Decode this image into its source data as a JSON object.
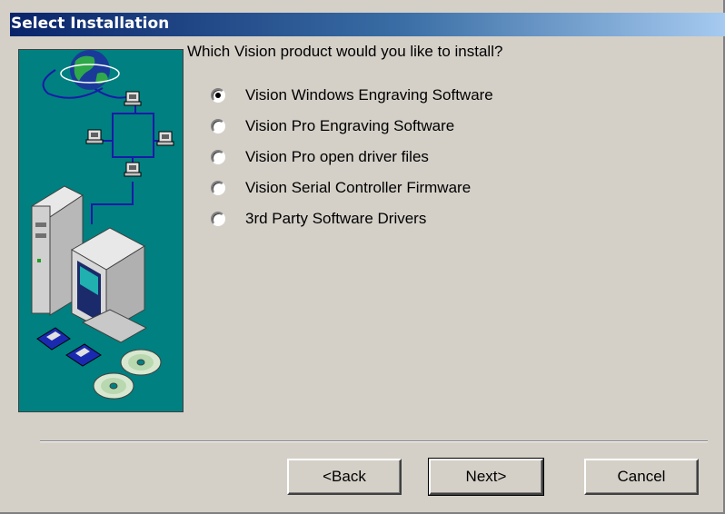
{
  "window": {
    "title": "Select Installation"
  },
  "main": {
    "question": "Which Vision product would you like to install?",
    "options": [
      {
        "label": "Vision Windows Engraving Software",
        "selected": true
      },
      {
        "label": "Vision Pro Engraving Software",
        "selected": false
      },
      {
        "label": "Vision Pro open driver files",
        "selected": false
      },
      {
        "label": "Vision Serial Controller Firmware",
        "selected": false
      },
      {
        "label": "3rd Party Software Drivers",
        "selected": false
      }
    ]
  },
  "buttons": {
    "back": "<Back",
    "next": "Next>",
    "cancel": "Cancel"
  },
  "colors": {
    "title_start": "#0a246a",
    "title_end": "#a6caf0",
    "panel": "#008080",
    "face": "#d4d0c8"
  },
  "icons": {
    "illustration": "network-computer-illustration",
    "globe": "globe-icon",
    "workstation": "workstation-icon",
    "floppy": "floppy-disk-icon",
    "cd": "cd-icon"
  }
}
